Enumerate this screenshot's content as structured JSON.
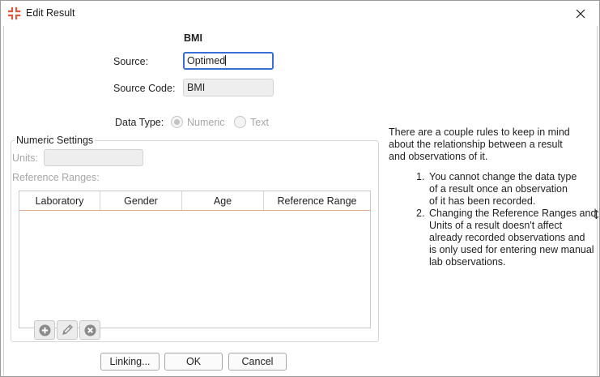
{
  "window": {
    "title": "Edit Result"
  },
  "form": {
    "result_name": "BMI",
    "source_label": "Source:",
    "source_value": "Optimed",
    "source_code_label": "Source Code:",
    "source_code_value": "BMI",
    "data_type_label": "Data Type:",
    "data_type_options": [
      "Numeric",
      "Text"
    ],
    "data_type_selected": "Numeric"
  },
  "numeric_settings": {
    "legend": "Numeric Settings",
    "units_label": "Units:",
    "units_value": "",
    "reference_ranges_label": "Reference Ranges:",
    "table_headers": [
      "Laboratory",
      "Gender",
      "Age",
      "Reference Range"
    ],
    "table_rows": []
  },
  "toolbar": {
    "add": "plus-icon",
    "edit": "pencil-icon",
    "remove": "remove-icon"
  },
  "info": {
    "intro_lines": [
      "There are a couple rules to keep in mind",
      "about the relationship between a result",
      "and observations of it."
    ],
    "rules": [
      {
        "num": "1.",
        "lines": [
          "You cannot change the data type",
          "of a result once an observation",
          "of it has been recorded."
        ]
      },
      {
        "num": "2.",
        "lines": [
          "Changing the Reference Ranges and",
          "Units of a result doesn't affect",
          "already recorded observations and",
          "is only used for entering new manual",
          "lab observations."
        ]
      }
    ]
  },
  "buttons": {
    "linking": "Linking...",
    "ok": "OK",
    "cancel": "Cancel"
  },
  "colors": {
    "focus_border": "#3a6fd8",
    "app_icon": "#e2583e",
    "header_underline": "#e3a98a"
  }
}
